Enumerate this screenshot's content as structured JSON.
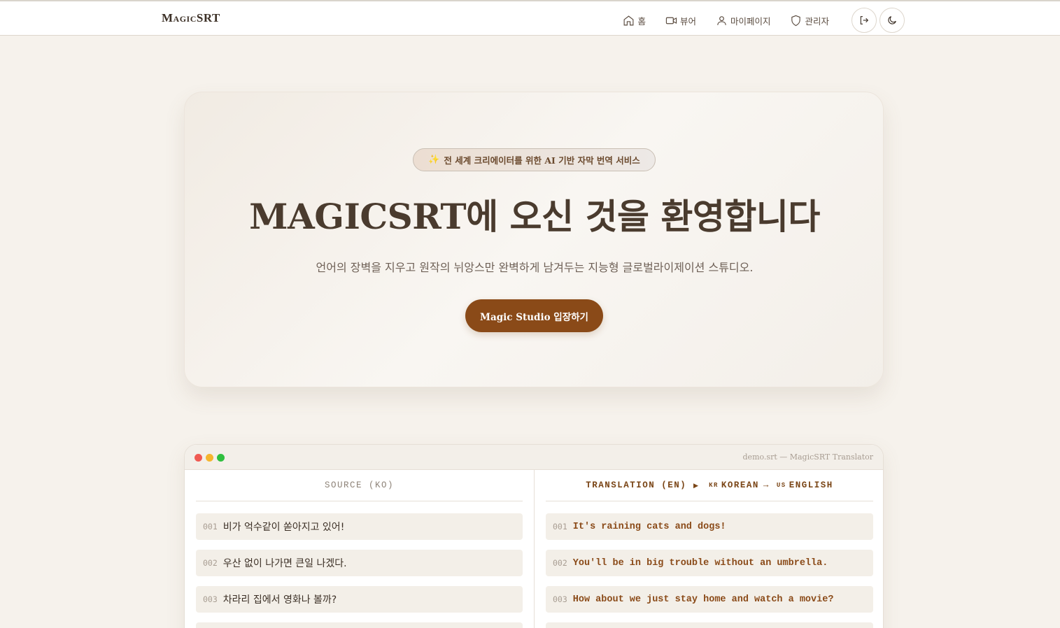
{
  "nav": {
    "logo": "MagicSRT",
    "links": [
      {
        "label": "홈",
        "icon": "home-icon"
      },
      {
        "label": "뷰어",
        "icon": "video-icon"
      },
      {
        "label": "마이페이지",
        "icon": "user-icon"
      },
      {
        "label": "관리자",
        "icon": "shield-icon"
      }
    ],
    "logout_icon": "logout-icon",
    "theme_icon": "moon-icon"
  },
  "hero": {
    "badge": "전 세계 크리에이터를 위한 AI 기반 자막 번역 서비스",
    "title": "MAGICSRT에 오신 것을 환영합니다",
    "subtitle": "언어의 장벽을 지우고 원작의 뉘앙스만 완벽하게 남겨두는 지능형 글로벌라이제이션 스튜디오.",
    "cta": "Magic Studio 입장하기"
  },
  "editor": {
    "filename": "demo.srt — MagicSRT Translator",
    "source_header": "SOURCE (KO)",
    "translation_header": "TRANSLATION (EN)",
    "arrow": "▸",
    "from_flag": "KR",
    "from_lang": "KOREAN",
    "direction": "→",
    "to_flag": "US",
    "to_lang": "ENGLISH",
    "source_rows": [
      {
        "num": "001",
        "text": "비가 억수같이 쏟아지고 있어!"
      },
      {
        "num": "002",
        "text": "우산 없이 나가면 큰일 나겠다."
      },
      {
        "num": "003",
        "text": "차라리 집에서 영화나 볼까?"
      }
    ],
    "translation_rows": [
      {
        "num": "001",
        "text": "It's raining cats and dogs!"
      },
      {
        "num": "002",
        "text": "You'll be in big trouble without an umbrella."
      },
      {
        "num": "003",
        "text": "How about we just stay home and watch a movie?"
      }
    ]
  },
  "colors": {
    "accent": "#8a4a18",
    "background": "#f6f2ec"
  }
}
